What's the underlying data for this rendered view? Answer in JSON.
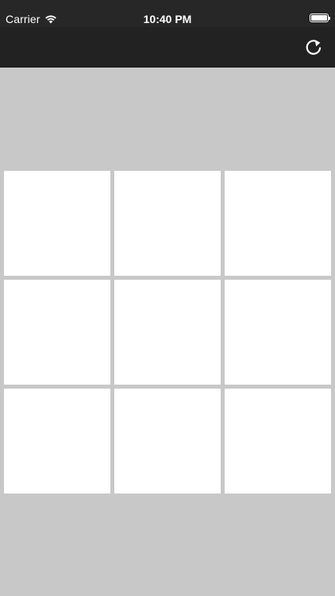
{
  "status_bar": {
    "carrier": "Carrier",
    "time": "10:40 PM",
    "icons": [
      "wifi-icon",
      "battery-icon"
    ]
  },
  "nav_bar": {
    "reset_icon": "refresh-icon"
  },
  "board": {
    "cells": [
      "",
      "",
      "",
      "",
      "",
      "",
      "",
      "",
      ""
    ]
  },
  "colors": {
    "background": "#c8c8c8",
    "bar": "#222222",
    "cell": "#ffffff"
  }
}
